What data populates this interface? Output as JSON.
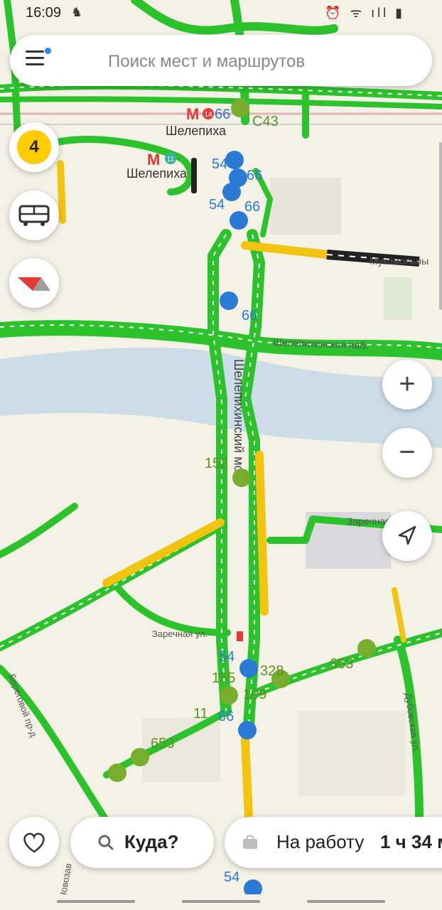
{
  "status_bar": {
    "time": "16:09",
    "right_icons": "⏰ ᯤ ıll ▮"
  },
  "search": {
    "placeholder": "Поиск мест и маршрутов"
  },
  "traffic": {
    "level": "4"
  },
  "map_labels": {
    "metro_1": "Шелепиха",
    "metro_1_line": "14",
    "metro_2": "Шелепиха",
    "metro_2_line": "11",
    "street_mukomolny": "Мукомольны",
    "street_shelepikhinskaya_nab": "Шелепихинская наб.",
    "street_bridge": "Шелепихинский мост",
    "street_zarechnaya_1": "Заречная ул.",
    "street_zarechnaya_2": "Заречная ул",
    "street_beregovoy": "Береговой пр-д",
    "street_dubovaya": "Дубовская ул.",
    "street_novozav": "Новозав"
  },
  "transit_labels": {
    "r66_a": "66",
    "c43": "С43",
    "r54_a": "54",
    "r66_b": "66",
    "r54_b": "54",
    "r66_c": "66",
    "r66_d": "66",
    "r152": "152",
    "r54_c": "54",
    "r155": "155",
    "r328": "328",
    "r109": "109",
    "r11": "11",
    "r66_e": "66",
    "r653_a": "653",
    "r653_b": "653",
    "r54_d": "54"
  },
  "bottom": {
    "where_label": "Куда?",
    "work_label": "На работу",
    "work_time": "1 ч 34 м"
  },
  "colors": {
    "traffic_free": "#2cc22c",
    "traffic_slow": "#f2c30f",
    "traffic_jam": "#222222",
    "water": "#cddde8",
    "transit_stop": "#78ad2e",
    "trolley_stop": "#2a7ad6"
  }
}
